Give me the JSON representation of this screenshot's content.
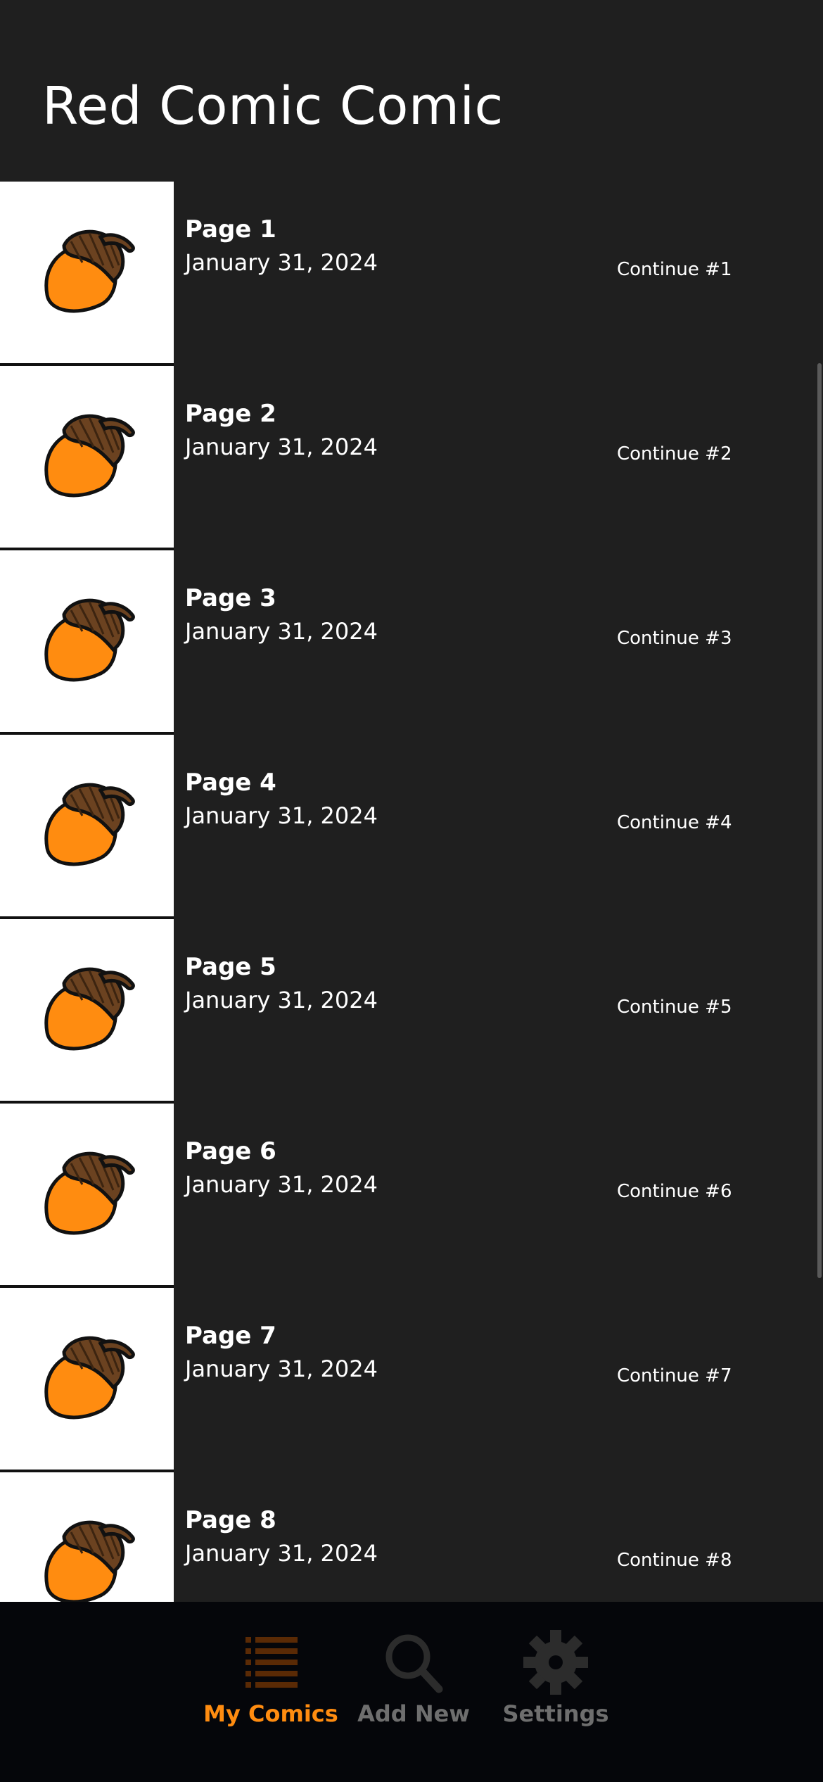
{
  "header": {
    "title": "Red Comic Comic"
  },
  "pages": [
    {
      "title": "Page 1",
      "date": "January 31, 2024",
      "continue_label": "Continue #1"
    },
    {
      "title": "Page 2",
      "date": "January 31, 2024",
      "continue_label": "Continue #2"
    },
    {
      "title": "Page 3",
      "date": "January 31, 2024",
      "continue_label": "Continue #3"
    },
    {
      "title": "Page 4",
      "date": "January 31, 2024",
      "continue_label": "Continue #4"
    },
    {
      "title": "Page 5",
      "date": "January 31, 2024",
      "continue_label": "Continue #5"
    },
    {
      "title": "Page 6",
      "date": "January 31, 2024",
      "continue_label": "Continue #6"
    },
    {
      "title": "Page 7",
      "date": "January 31, 2024",
      "continue_label": "Continue #7"
    },
    {
      "title": "Page 8",
      "date": "January 31, 2024",
      "continue_label": "Continue #8"
    }
  ],
  "thumbnail_icon": "acorn-icon",
  "tabs": [
    {
      "label": "My Comics",
      "icon": "list-icon",
      "active": true
    },
    {
      "label": "Add New",
      "icon": "search-icon",
      "active": false
    },
    {
      "label": "Settings",
      "icon": "gear-icon",
      "active": false
    }
  ],
  "colors": {
    "background": "#1f1f1f",
    "tabbar": "#05060a",
    "accent": "#ff8c10",
    "inactive": "#6e6e6e",
    "acorn_body": "#ff8c10",
    "acorn_cap": "#6b4220"
  }
}
